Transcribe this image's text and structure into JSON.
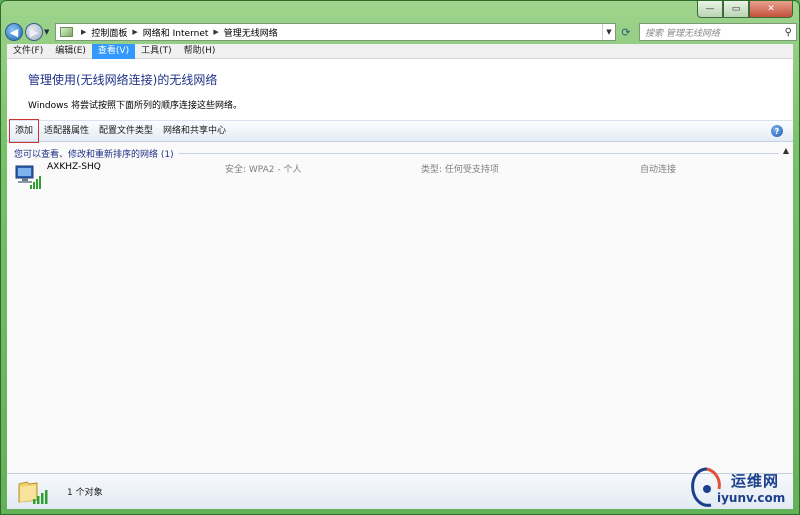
{
  "window": {
    "caption_buttons": [
      {
        "icon": "minimize-icon",
        "glyph": "—"
      },
      {
        "icon": "maximize-icon",
        "glyph": "▭"
      },
      {
        "icon": "close-icon",
        "glyph": "✕"
      }
    ]
  },
  "navigation": {
    "back_glyph": "◀",
    "forward_glyph": "▶",
    "breadcrumbs": [
      "控制面板",
      "网络和 Internet",
      "管理无线网络"
    ],
    "search_placeholder": "搜索 管理无线网络"
  },
  "menu": {
    "items": [
      "文件(F)",
      "编辑(E)",
      "查看(V)",
      "工具(T)",
      "帮助(H)"
    ],
    "active_index": 2
  },
  "header": {
    "title": "管理使用(无线网络连接)的无线网络",
    "description": "Windows 将尝试按照下面所列的顺序连接这些网络。"
  },
  "toolbar": {
    "buttons": [
      "添加",
      "适配器属性",
      "配置文件类型",
      "网络和共享中心"
    ],
    "focused_index": 0,
    "help_glyph": "?"
  },
  "networks": {
    "group_label": "您可以查看、修改和重新排序的网络 (1)",
    "rows": [
      {
        "name": "AXKHZ-SHQ",
        "security": "安全: WPA2 - 个人",
        "type": "类型: 任何受支持项",
        "mode": "自动连接"
      }
    ]
  },
  "status": {
    "text": "1 个对象"
  },
  "watermark": {
    "cn": "运维网",
    "en": "iyunv.com"
  },
  "colors": {
    "title_blue": "#1e3287",
    "menu_active": "#3399ff",
    "window_frame": "#79c06b"
  }
}
